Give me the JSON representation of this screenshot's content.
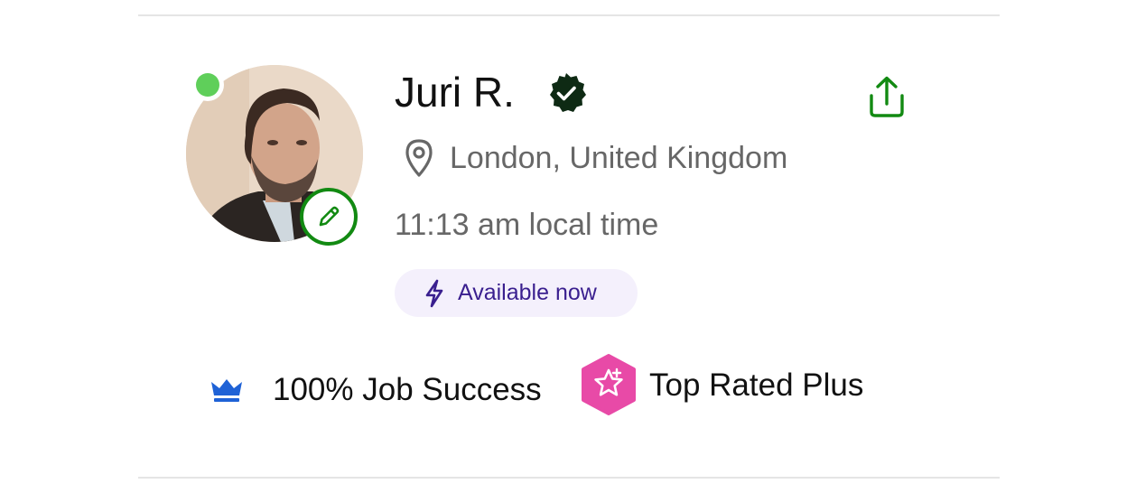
{
  "profile": {
    "name": "Juri R.",
    "location": "London, United Kingdom",
    "local_time": "11:13 am local time",
    "availability": "Available now",
    "online": true,
    "verified": true
  },
  "badges": {
    "job_success": "100% Job Success",
    "top_rated": "Top Rated Plus"
  },
  "icons": {
    "online": "online-status-dot",
    "edit": "pencil-icon",
    "verified": "verified-badge-icon",
    "share": "share-icon",
    "location": "map-pin-icon",
    "availability": "lightning-bolt-icon",
    "job_success": "crown-icon",
    "top_rated": "star-hexagon-icon"
  },
  "colors": {
    "brand_green": "#128a12",
    "online_green": "#5fcf5a",
    "muted_text": "#676767",
    "availability_bg": "#f4f0fc",
    "availability_text": "#3a1f8f",
    "crown_blue": "#1f62d6",
    "top_rated_pink": "#e84aa7"
  }
}
